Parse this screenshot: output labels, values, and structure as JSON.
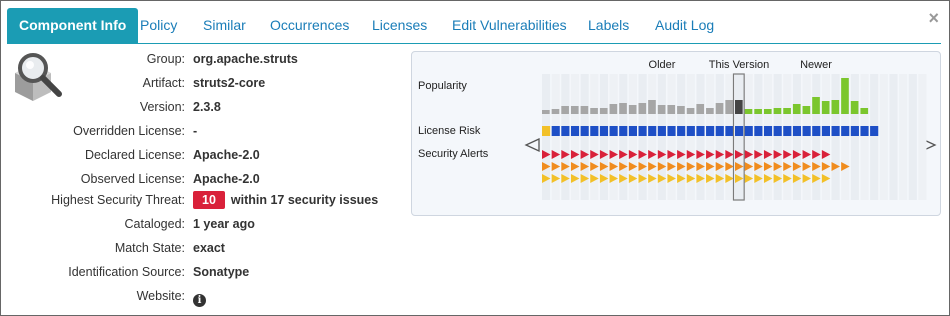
{
  "tabs": [
    {
      "label": "Component Info"
    },
    {
      "label": "Policy"
    },
    {
      "label": "Similar"
    },
    {
      "label": "Occurrences"
    },
    {
      "label": "Licenses"
    },
    {
      "label": "Edit Vulnerabilities"
    },
    {
      "label": "Labels"
    },
    {
      "label": "Audit Log"
    }
  ],
  "close_glyph": "×",
  "fields": {
    "group": {
      "label": "Group:",
      "value": "org.apache.struts"
    },
    "artifact": {
      "label": "Artifact:",
      "value": "struts2-core"
    },
    "version": {
      "label": "Version:",
      "value": "2.3.8"
    },
    "overridden_license": {
      "label": "Overridden License:",
      "value": "-"
    },
    "declared_license": {
      "label": "Declared License:",
      "value": "Apache-2.0"
    },
    "observed_license": {
      "label": "Observed License:",
      "value": "Apache-2.0"
    },
    "highest_threat": {
      "label": "Highest Security Threat:",
      "badge": "10",
      "text": "within 17 security issues"
    },
    "cataloged": {
      "label": "Cataloged:",
      "value": "1 year ago"
    },
    "match_state": {
      "label": "Match State:",
      "value": "exact"
    },
    "identification_source": {
      "label": "Identification Source:",
      "value": "Sonatype"
    },
    "website": {
      "label": "Website:",
      "icon": "info-icon",
      "glyph": "i"
    }
  },
  "chart": {
    "header_older": "Older",
    "header_this": "This Version",
    "header_newer": "Newer",
    "row_popularity": "Popularity",
    "row_license": "License Risk",
    "row_security": "Security Alerts",
    "nav_left_icon": "triangle-left-icon",
    "nav_right_icon": "triangle-right-icon",
    "popularity_colors": {
      "older": "#a6a6a6",
      "current": "#444444",
      "newer": "#7bc62d",
      "empty": "#e5e8ec"
    },
    "license_colors": {
      "yellow": "#f2c028",
      "blue": "#1e4fc6"
    },
    "security_colors": {
      "red": "#d9213a",
      "orange": "#f08c1e",
      "yellow": "#f2c028"
    }
  },
  "colors": {
    "accent": "#1b9cb4",
    "link": "#1a7db8",
    "threat": "#d9213a"
  }
}
